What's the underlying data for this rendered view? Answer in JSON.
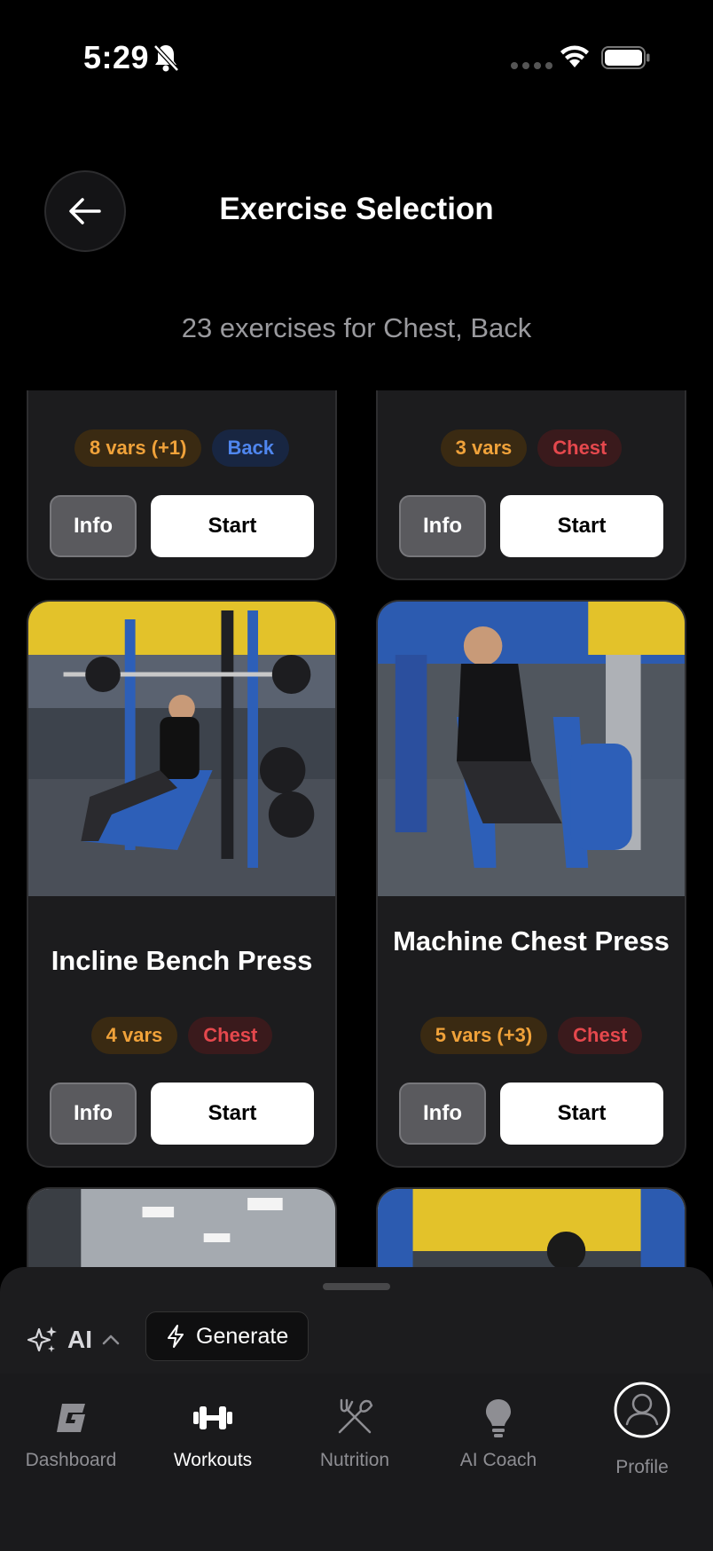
{
  "status_bar": {
    "time": "5:29"
  },
  "header": {
    "title": "Exercise Selection",
    "subtitle": "23 exercises for Chest, Back"
  },
  "cards": [
    {
      "title": "",
      "badges": [
        {
          "label": "8 vars (+1)",
          "kind": "vars"
        },
        {
          "label": "Back",
          "kind": "back"
        }
      ],
      "info_label": "Info",
      "start_label": "Start"
    },
    {
      "title": "",
      "badges": [
        {
          "label": "3 vars",
          "kind": "vars"
        },
        {
          "label": "Chest",
          "kind": "chest"
        }
      ],
      "info_label": "Info",
      "start_label": "Start"
    },
    {
      "title": "Incline Bench Press",
      "badges": [
        {
          "label": "4 vars",
          "kind": "vars"
        },
        {
          "label": "Chest",
          "kind": "chest"
        }
      ],
      "info_label": "Info",
      "start_label": "Start"
    },
    {
      "title": "Machine Chest Press",
      "badges": [
        {
          "label": "5 vars (+3)",
          "kind": "vars"
        },
        {
          "label": "Chest",
          "kind": "chest"
        }
      ],
      "info_label": "Info",
      "start_label": "Start"
    }
  ],
  "bottom_sheet": {
    "ai_label": "AI",
    "generate_label": "Generate"
  },
  "tabs": [
    {
      "label": "Dashboard",
      "icon": "g-logo-icon",
      "active": false
    },
    {
      "label": "Workouts",
      "icon": "dumbbell-icon",
      "active": true
    },
    {
      "label": "Nutrition",
      "icon": "fork-knife-icon",
      "active": false
    },
    {
      "label": "AI Coach",
      "icon": "lightbulb-icon",
      "active": false
    },
    {
      "label": "Profile",
      "icon": "person-icon",
      "active": false
    }
  ],
  "colors": {
    "background": "#000000",
    "card": "#1c1c1e",
    "vars_badge": "#f0a23a",
    "chest_badge": "#e5484d",
    "back_badge": "#4f86ee"
  }
}
